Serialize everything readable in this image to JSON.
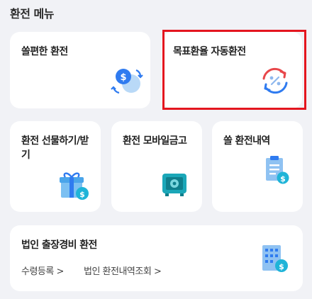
{
  "section": {
    "title": "환전 메뉴"
  },
  "cards": {
    "convenient_exchange": {
      "label": "쏠편한 환전"
    },
    "target_rate_auto_exchange": {
      "label": "목표환율 자동환전"
    },
    "gift_exchange": {
      "label": "환전 선물하기/받기"
    },
    "mobile_safe": {
      "label": "환전 모바일금고"
    },
    "sol_history": {
      "label": "쏠 환전내역"
    },
    "corporate_trip": {
      "label": "법인 출장경비 환전",
      "links": [
        "수령등록 >",
        "법인 환전내역조회 >"
      ]
    }
  },
  "highlight": {
    "color": "#e4161f"
  },
  "icons": {
    "dollar": "dollar-coin-exchange-icon",
    "target": "rate-target-icon",
    "gift": "gift-box-icon",
    "safe": "safe-vault-icon",
    "receipt": "receipt-icon",
    "building": "building-icon"
  }
}
